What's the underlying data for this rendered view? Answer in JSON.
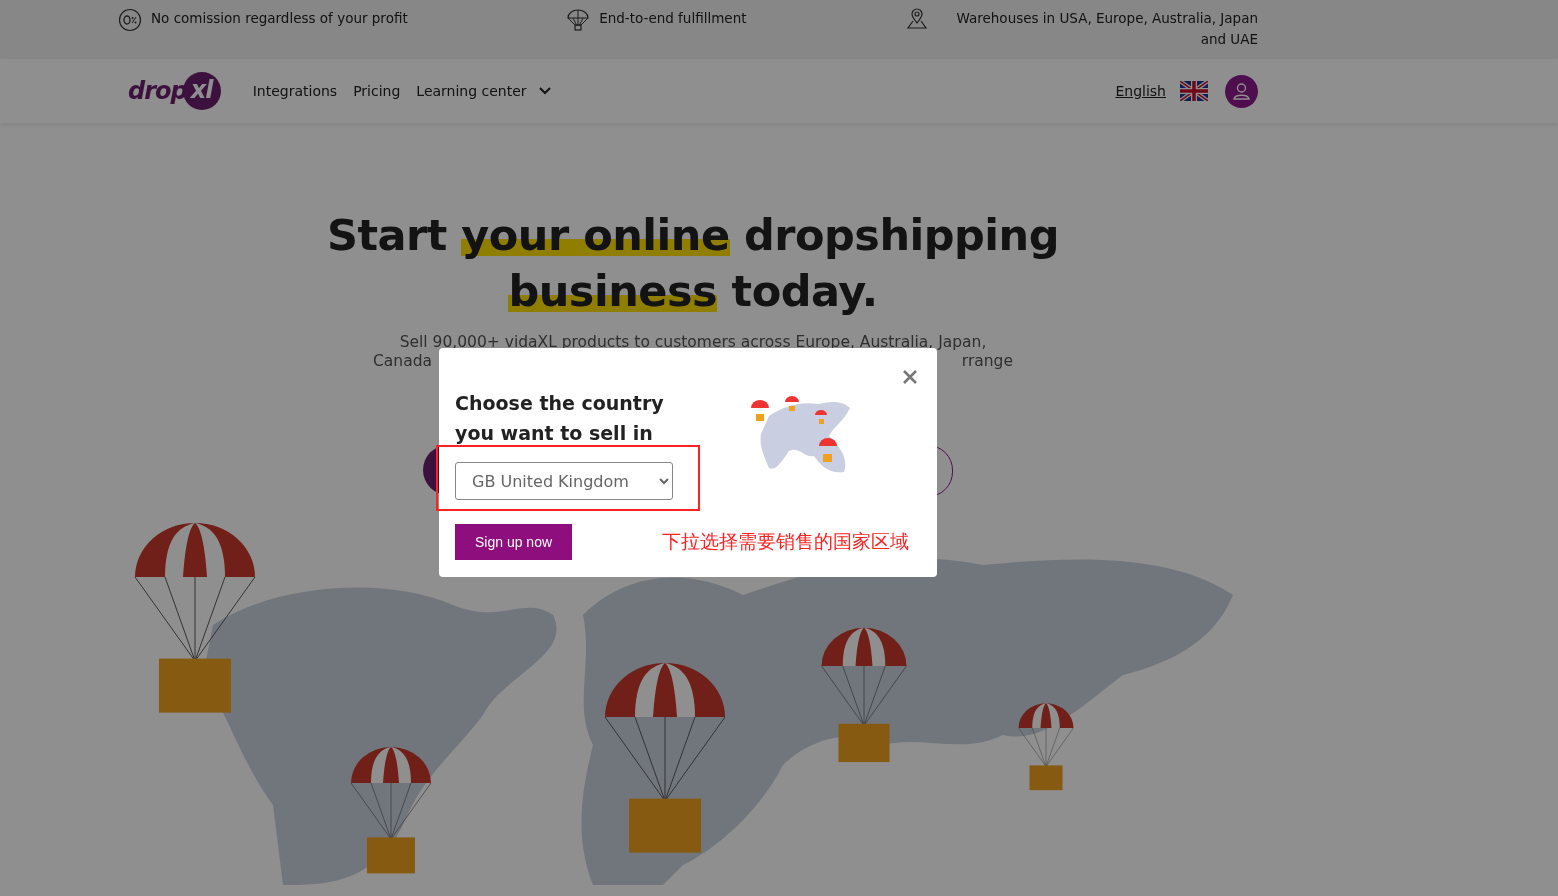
{
  "top_bar": {
    "items": [
      {
        "kind": "percent",
        "text": "No comission regardless of your profit"
      },
      {
        "kind": "parachute",
        "text": "End-to-end fulfillment"
      },
      {
        "kind": "location",
        "text": "Warehouses in USA, Europe, Australia, Japan and UAE"
      }
    ]
  },
  "nav": {
    "logo": {
      "text": "drop",
      "mark": "xl"
    },
    "links": [
      {
        "label": "Integrations",
        "dropdown": false
      },
      {
        "label": "Pricing",
        "dropdown": false
      },
      {
        "label": "Learning center",
        "dropdown": true
      }
    ],
    "language": "English"
  },
  "hero": {
    "title": [
      [
        {
          "text": "Start ",
          "highlight": false
        },
        {
          "text": "your online",
          "highlight": true
        },
        {
          "text": " dropshipping",
          "highlight": false
        }
      ],
      [
        {
          "text": "business",
          "highlight": true
        },
        {
          "text": " today.",
          "highlight": false
        }
      ]
    ],
    "subtitle_line_1": "Sell 90,000+ vidaXL products to customers across Europe, Australia, Japan,",
    "subtitle_line_2_left": "Canada",
    "subtitle_line_2_right": "rrange"
  },
  "modal": {
    "title": "Choose the country you want to sell in",
    "country_select": {
      "value": "GB United Kingdom"
    },
    "button": "Sign up now",
    "annotation": "下拉选择需要销售的国家区域"
  }
}
